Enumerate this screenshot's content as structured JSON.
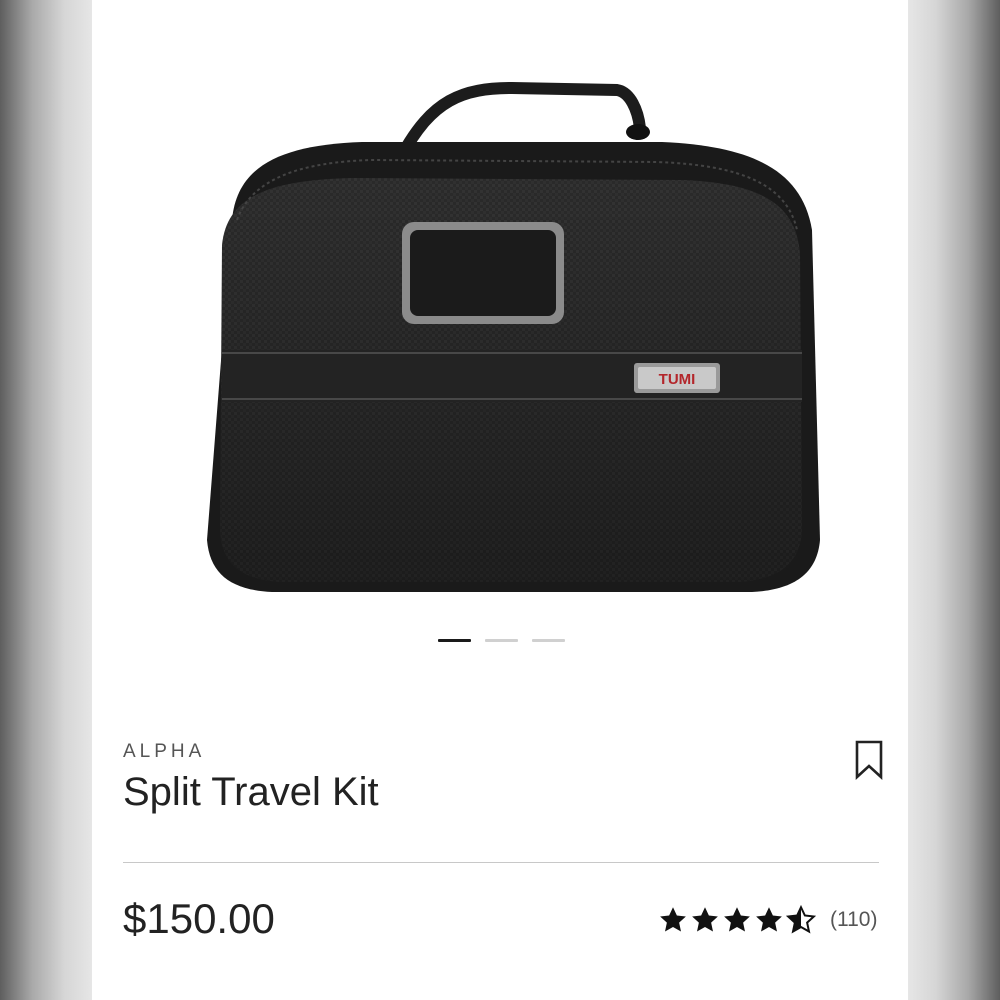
{
  "product": {
    "collection": "ALPHA",
    "name": "Split Travel Kit",
    "price": "$150.00",
    "brand_badge": "TUMI",
    "rating_value": 4.5,
    "rating_max": 5,
    "review_count": "(110)"
  },
  "carousel": {
    "total_images": 3,
    "active_index": 0
  },
  "icons": {
    "save": "bookmark-icon",
    "star": "star-icon"
  },
  "colors": {
    "text_primary": "#222222",
    "text_secondary": "#555555",
    "star": "#111111",
    "badge_red": "#b3262b"
  }
}
